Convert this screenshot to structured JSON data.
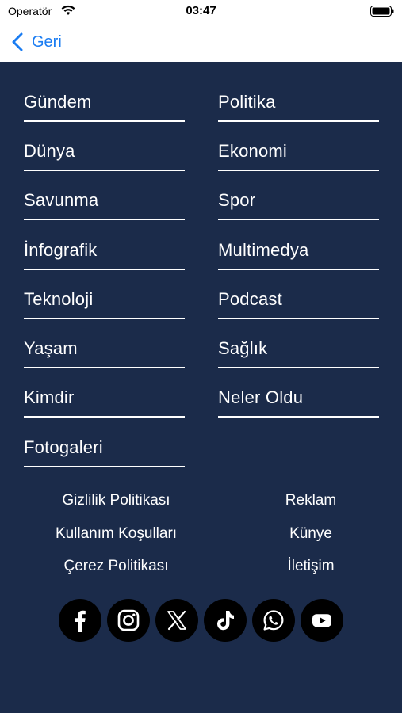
{
  "status_bar": {
    "carrier": "Operatör",
    "time": "03:47"
  },
  "nav": {
    "back_label": "Geri"
  },
  "colors": {
    "panel_bg": "#1b2b4a",
    "accent_blue": "#1a7cf2",
    "text_white": "#ffffff"
  },
  "categories": {
    "left": [
      "Gündem",
      "Dünya",
      "Savunma",
      "İnfografik",
      "Teknoloji",
      "Yaşam",
      "Kimdir",
      "Fotogaleri"
    ],
    "right": [
      "Politika",
      "Ekonomi",
      "Spor",
      "Multimedya",
      "Podcast",
      "Sağlık",
      "Neler Oldu"
    ]
  },
  "footer": {
    "left": [
      "Gizlilik Politikası",
      "Kullanım Koşulları",
      "Çerez Politikası"
    ],
    "right": [
      "Reklam",
      "Künye",
      "İletişim"
    ]
  },
  "social": [
    "facebook-icon",
    "instagram-icon",
    "x-icon",
    "tiktok-icon",
    "whatsapp-icon",
    "youtube-icon"
  ]
}
